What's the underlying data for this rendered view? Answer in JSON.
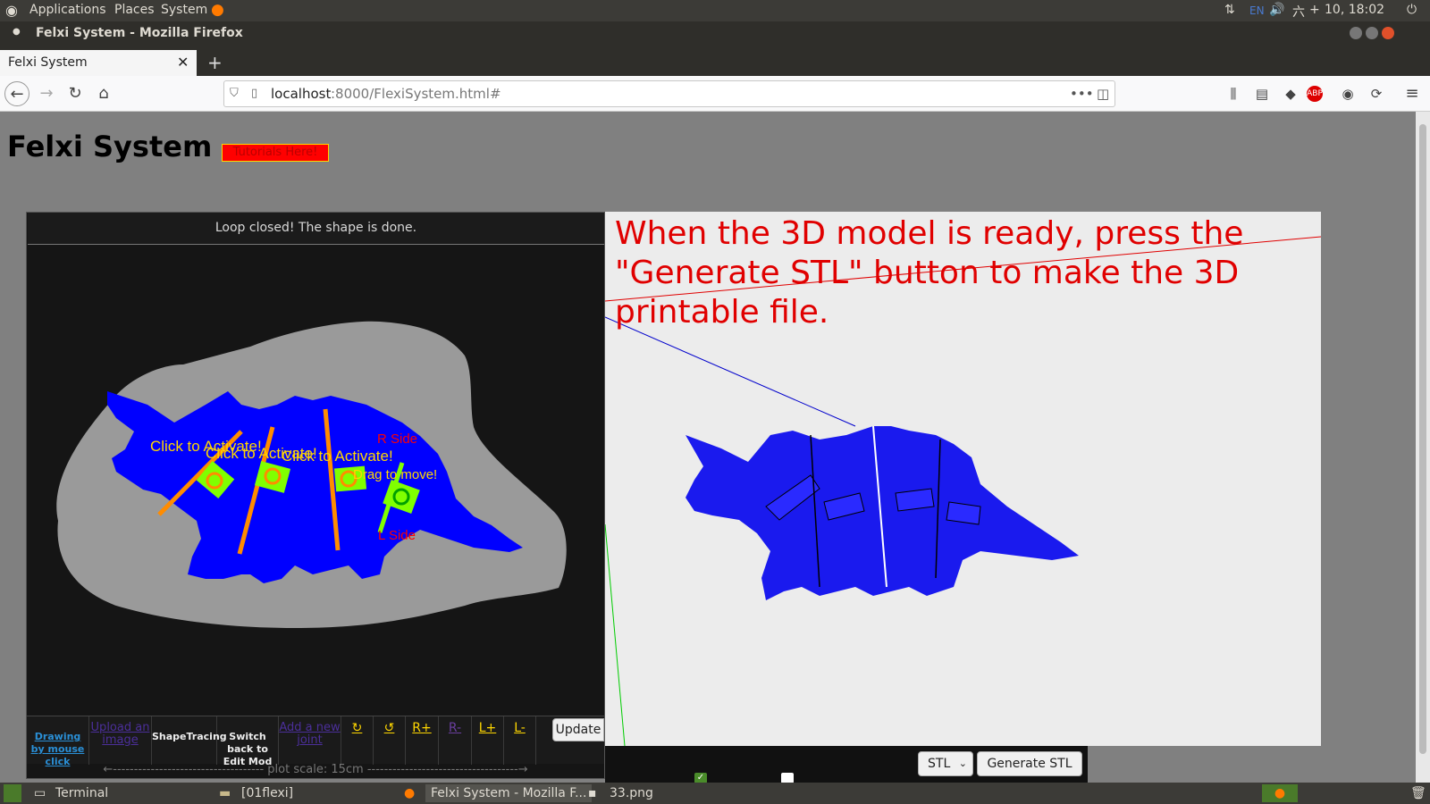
{
  "os_topbar": {
    "applications": "Applications",
    "places": "Places",
    "system": "System",
    "lang": "EN",
    "datetime": "10, 18:02",
    "day": "六"
  },
  "window_title": "Felxi System - Mozilla Firefox",
  "browser": {
    "tab_title": "Felxi System",
    "url_host": "localhost",
    "url_path": ":8000/FlexiSystem.html#"
  },
  "page": {
    "title": "Felxi System",
    "tutorial_button": "Tutorials Here!",
    "status_message": "Loop closed! The shape is done.",
    "instruction": "When the 3D model is ready, press the \"Generate STL\" button to make the 3D printable file."
  },
  "canvas_labels": {
    "click1": "Click to Activate!",
    "click2": "Click to Activate!",
    "click3": "Click to Activate!",
    "r_side": "R Side",
    "drag": "Drag to move!",
    "l_side": "L Side"
  },
  "toolbar": {
    "drawing": "Drawing by mouse click",
    "upload": "Upload an image",
    "shapetracing": "ShapeTracing",
    "switch": "Switch back to Edit Mod",
    "add_joint": "Add a new joint",
    "rot_cw": "↻",
    "rot_ccw": "↺",
    "r_plus": "R+",
    "r_minus": "R-",
    "l_plus": "L+",
    "l_minus": "L-",
    "update": "Update",
    "plot_scale": "←------------------------------------ plot scale: 15cm ------------------------------------→"
  },
  "export": {
    "format": "STL",
    "generate": "Generate STL"
  },
  "taskbar": {
    "terminal": "Terminal",
    "folder": "[01flexi]",
    "firefox": "Felxi System - Mozilla F...",
    "image": "33.png"
  },
  "colors": {
    "model_blue": "#1010ee",
    "instruction_red": "#e00000",
    "joint_orange": "#ff8c00",
    "joint_green": "#80ff00"
  }
}
